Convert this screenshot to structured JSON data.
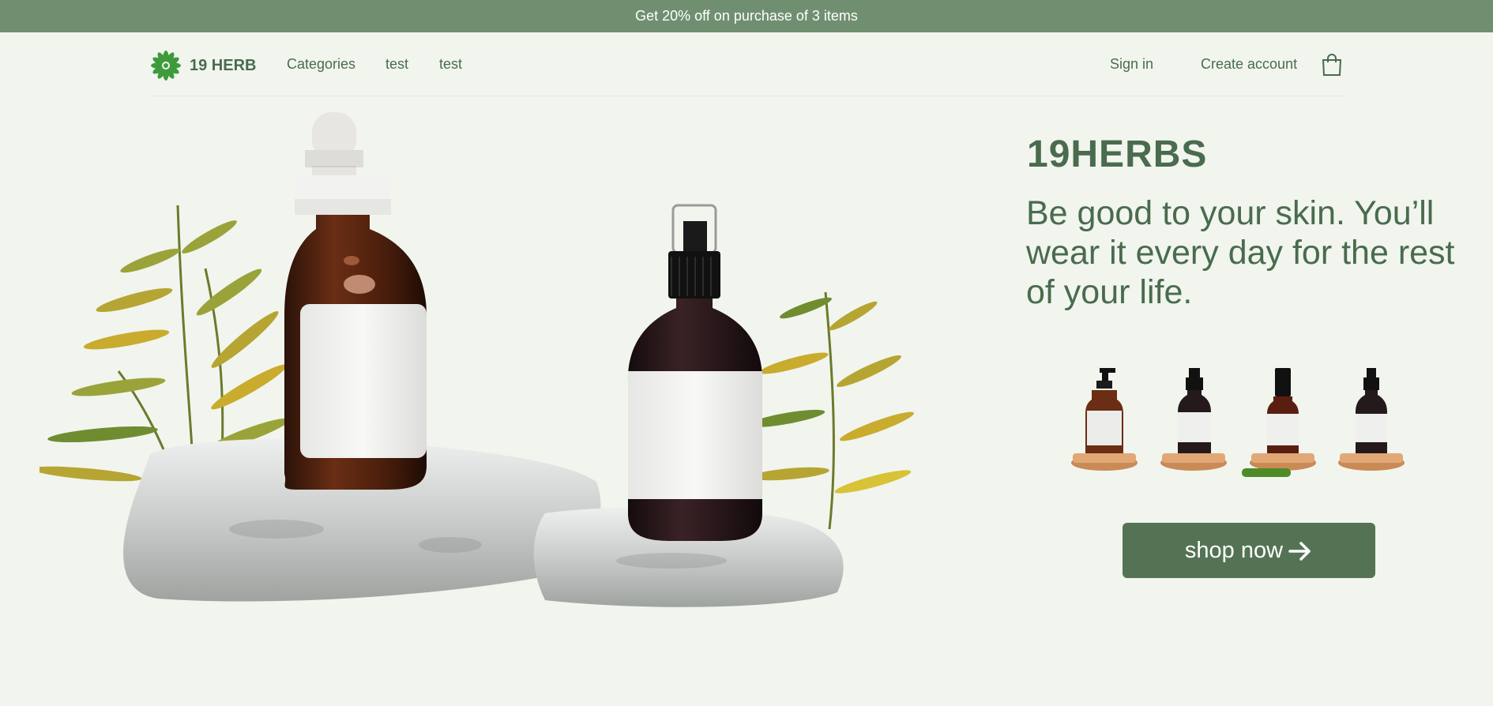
{
  "promo": {
    "text": "Get 20% off on purchase of 3 items"
  },
  "nav": {
    "logo_text": "19 HERB",
    "links": [
      "Categories",
      "test",
      "test"
    ],
    "sign_in": "Sign in",
    "create_account": "Create account",
    "cart_icon": "shopping-bag-icon"
  },
  "hero": {
    "brand": "19HERBS",
    "tagline": "Be good to your skin. You’ll wear it every day for the rest of your life.",
    "cta": "shop now",
    "cta_icon": "arrow-right-icon"
  },
  "thumbnails": {
    "count": 4,
    "active_index": 2
  },
  "colors": {
    "promo_bg": "#708f70",
    "page_bg": "#f1f5ee",
    "text_green": "#4a6b4e",
    "button_bg": "#547354",
    "indicator": "#4f8b26"
  }
}
